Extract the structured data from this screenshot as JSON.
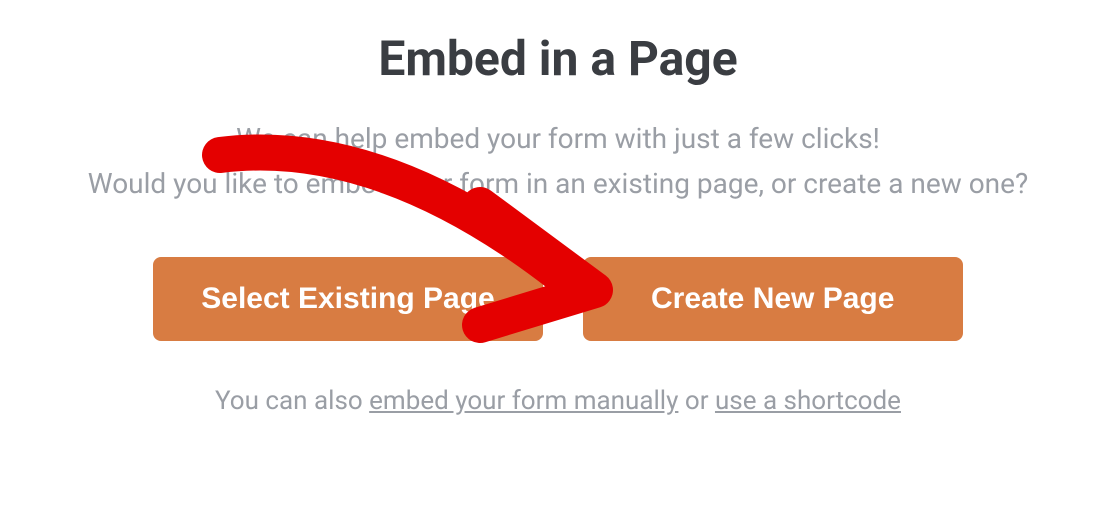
{
  "title": "Embed in a Page",
  "description_line1": "We can help embed your form with just a few clicks!",
  "description_line2": "Would you like to embed your form in an existing page, or create a new one?",
  "buttons": {
    "select_existing": "Select Existing Page",
    "create_new": "Create New Page"
  },
  "footer": {
    "prefix": "You can also ",
    "link1": "embed your form manually",
    "middle": " or ",
    "link2": "use a shortcode"
  }
}
